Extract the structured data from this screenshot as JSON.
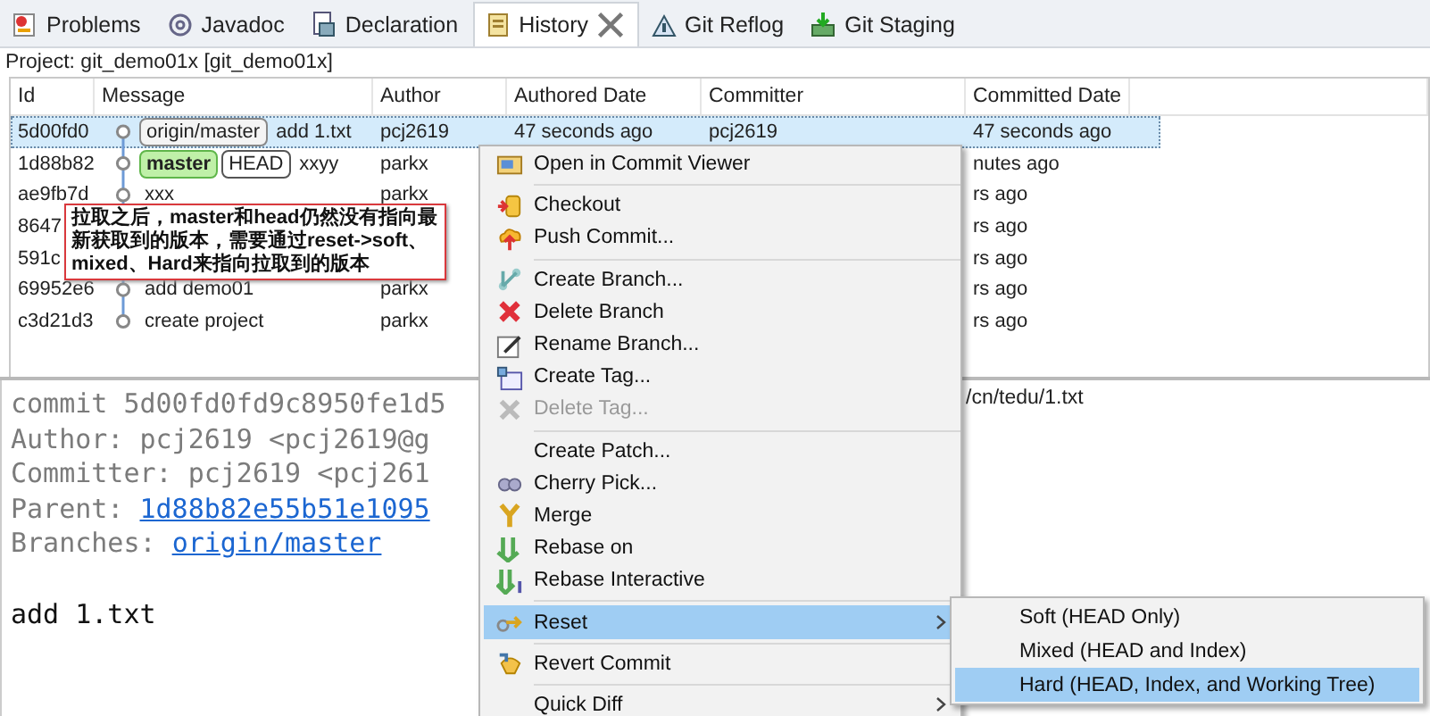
{
  "tabs": [
    {
      "label": "Problems",
      "selected": false,
      "closable": false
    },
    {
      "label": "Javadoc",
      "selected": false,
      "closable": false
    },
    {
      "label": "Declaration",
      "selected": false,
      "closable": false
    },
    {
      "label": "History",
      "selected": true,
      "closable": true
    },
    {
      "label": "Git Reflog",
      "selected": false,
      "closable": false
    },
    {
      "label": "Git Staging",
      "selected": false,
      "closable": false
    }
  ],
  "project": "Project: git_demo01x [git_demo01x]",
  "table": {
    "columns": [
      "Id",
      "Message",
      "Author",
      "Authored Date",
      "Committer",
      "Committed Date"
    ],
    "rows": [
      {
        "id": "5d00fd0",
        "refs": [
          {
            "label": "origin/master",
            "kind": "remote"
          }
        ],
        "message": "add 1.txt",
        "author": "pcj2619",
        "authored_date": "47 seconds ago",
        "committer": "pcj2619",
        "committed_date": "47 seconds ago",
        "selected": true
      },
      {
        "id": "1d88b82",
        "refs": [
          {
            "label": "master",
            "kind": "local"
          },
          {
            "label": "HEAD",
            "kind": "head"
          }
        ],
        "message": "xxyy",
        "author": "parkx",
        "committed_date": "nutes ago",
        "selected": false
      },
      {
        "id": "ae9fb7d",
        "message": "xxx",
        "author": "parkx",
        "committed_date": "rs ago",
        "selected": false
      },
      {
        "id": "8647",
        "committed_date": "rs ago",
        "selected": false
      },
      {
        "id": "591c",
        "committed_date": "rs ago",
        "selected": false
      },
      {
        "id": "69952e6",
        "message": "add demo01",
        "author": "parkx",
        "committed_date": "rs ago",
        "selected": false
      },
      {
        "id": "c3d21d3",
        "message": "create project",
        "author": "parkx",
        "committed_date": "rs ago",
        "selected": false
      }
    ]
  },
  "note": "拉取之后，master和head仍然没有指向最新获取到的版本，需要通过reset->soft、mixed、Hard来指向拉取到的版本",
  "details": {
    "lines": [
      {
        "kind": "plain",
        "text": "commit 5d00fd0fd9c8950fe1d5"
      },
      {
        "kind": "plain",
        "text": "Author: pcj2619 <pcj2619@g"
      },
      {
        "kind": "plain",
        "text": "Committer: pcj2619 <pcj261"
      },
      {
        "kind": "link",
        "label": "Parent: ",
        "text": "1d88b82e55b51e1095"
      },
      {
        "kind": "link",
        "label": "Branches: ",
        "text": "origin/master"
      },
      {
        "kind": "blank"
      },
      {
        "kind": "message",
        "text": "add 1.txt"
      }
    ],
    "files": [
      "/cn/tedu/1.txt"
    ]
  },
  "menu": {
    "items": [
      {
        "kind": "item",
        "label": "Open in Commit Viewer",
        "disabled": false,
        "selected": false,
        "submenu": false
      },
      {
        "kind": "separator"
      },
      {
        "kind": "item",
        "label": "Checkout",
        "disabled": false,
        "selected": false,
        "submenu": false
      },
      {
        "kind": "item",
        "label": "Push Commit...",
        "disabled": false,
        "selected": false,
        "submenu": false
      },
      {
        "kind": "separator"
      },
      {
        "kind": "item",
        "label": "Create Branch...",
        "disabled": false,
        "selected": false,
        "submenu": false
      },
      {
        "kind": "item",
        "label": "Delete Branch",
        "disabled": false,
        "selected": false,
        "submenu": false
      },
      {
        "kind": "item",
        "label": "Rename Branch...",
        "disabled": false,
        "selected": false,
        "submenu": false
      },
      {
        "kind": "item",
        "label": "Create Tag...",
        "disabled": false,
        "selected": false,
        "submenu": false
      },
      {
        "kind": "item",
        "label": "Delete Tag...",
        "disabled": true,
        "selected": false,
        "submenu": false
      },
      {
        "kind": "separator"
      },
      {
        "kind": "item",
        "label": "Create Patch...",
        "disabled": false,
        "selected": false,
        "submenu": false
      },
      {
        "kind": "item",
        "label": "Cherry Pick...",
        "disabled": false,
        "selected": false,
        "submenu": false
      },
      {
        "kind": "item",
        "label": "Merge",
        "disabled": false,
        "selected": false,
        "submenu": false
      },
      {
        "kind": "item",
        "label": "Rebase on",
        "disabled": false,
        "selected": false,
        "submenu": false
      },
      {
        "kind": "item",
        "label": "Rebase Interactive",
        "disabled": false,
        "selected": false,
        "submenu": false
      },
      {
        "kind": "separator"
      },
      {
        "kind": "item",
        "label": "Reset",
        "disabled": false,
        "selected": true,
        "submenu": true
      },
      {
        "kind": "separator"
      },
      {
        "kind": "item",
        "label": "Revert Commit",
        "disabled": false,
        "selected": false,
        "submenu": false
      },
      {
        "kind": "separator"
      },
      {
        "kind": "item",
        "label": "Quick Diff",
        "disabled": false,
        "selected": false,
        "submenu": true
      }
    ]
  },
  "submenu": {
    "items": [
      {
        "label": "Soft (HEAD Only)",
        "selected": false
      },
      {
        "label": "Mixed (HEAD and Index)",
        "selected": false
      },
      {
        "label": "Hard (HEAD, Index, and Working Tree)",
        "selected": true
      }
    ]
  }
}
